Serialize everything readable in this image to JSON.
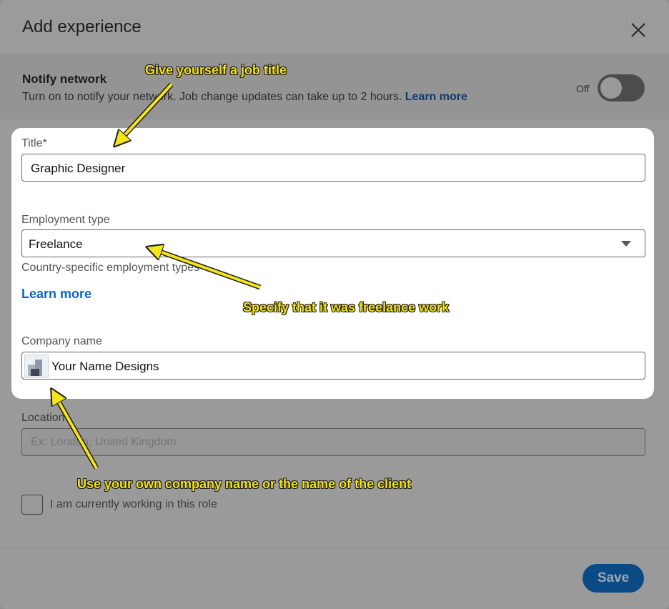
{
  "modal": {
    "title": "Add experience",
    "close_icon": "close-icon"
  },
  "notify": {
    "title": "Notify network",
    "description": "Turn on to notify your network. Job change updates can take up to 2 hours.",
    "link": "Learn more",
    "toggle_state": "Off"
  },
  "form": {
    "title_label": "Title*",
    "title_value": "Graphic Designer",
    "employment_label": "Employment type",
    "employment_value": "Freelance",
    "employment_hint": "Country-specific employment types",
    "employment_link": "Learn more",
    "company_label": "Company name",
    "company_value": "Your Name Designs",
    "location_label": "Location",
    "location_placeholder": "Ex: London, United Kingdom",
    "current_role_label": "I am currently working in this role",
    "current_role_checked": false
  },
  "footer": {
    "save_label": "Save"
  },
  "annotations": {
    "title_note": "Give yourself a job title",
    "employment_note": "Specify that it was freelance work",
    "company_note": "Use your own company name or the name of the client"
  },
  "colors": {
    "link": "#0a66c2",
    "primary_button": "#0b4a85",
    "annotation_text": "#f4e313",
    "annotation_arrow": "#f5e61b"
  }
}
